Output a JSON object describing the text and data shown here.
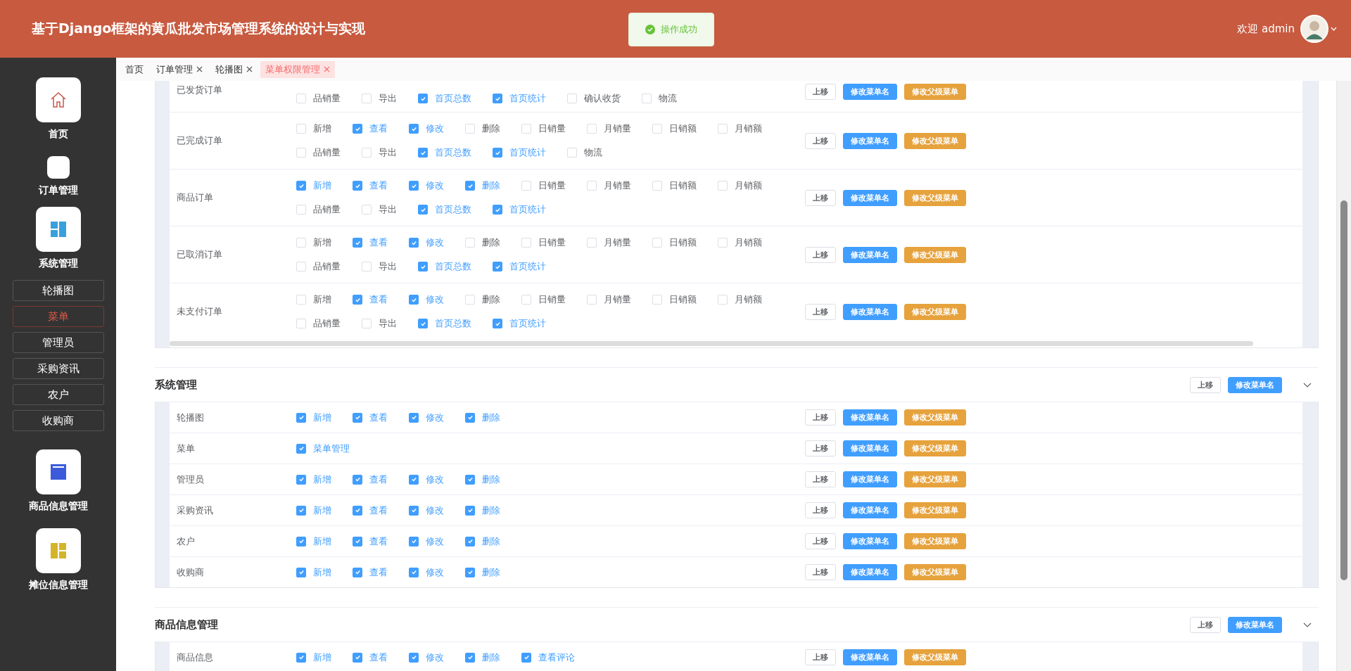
{
  "header": {
    "title": "基于Django框架的黄瓜批发市场管理系统的设计与实现",
    "toast": "操作成功",
    "welcome": "欢迎 admin"
  },
  "sidebar": {
    "items": [
      {
        "label": "首页"
      },
      {
        "label": "订单管理"
      },
      {
        "label": "系统管理",
        "children": [
          {
            "label": "轮播图",
            "selected": false
          },
          {
            "label": "菜单",
            "selected": true
          },
          {
            "label": "管理员",
            "selected": false
          },
          {
            "label": "采购资讯",
            "selected": false
          },
          {
            "label": "农户",
            "selected": false
          },
          {
            "label": "收购商",
            "selected": false
          }
        ]
      },
      {
        "label": "商品信息管理"
      },
      {
        "label": "摊位信息管理"
      }
    ]
  },
  "tabs": [
    {
      "label": "首页",
      "selected": false,
      "closable": false
    },
    {
      "label": "订单管理",
      "selected": false,
      "closable": true
    },
    {
      "label": "轮播图",
      "selected": false,
      "closable": true
    },
    {
      "label": "菜单权限管理",
      "selected": true,
      "closable": true
    }
  ],
  "groups": [
    {
      "rows": [
        {
          "label": "已发货订单",
          "checks": [
            {
              "label": "品销量",
              "checked": false
            },
            {
              "label": "导出",
              "checked": false
            },
            {
              "label": "首页总数",
              "checked": true
            },
            {
              "label": "首页统计",
              "checked": true
            },
            {
              "label": "确认收货",
              "checked": false
            },
            {
              "label": "物流",
              "checked": false
            }
          ],
          "buttons": [
            {
              "label": "上移",
              "kind": "plain"
            },
            {
              "label": "修改菜单名",
              "kind": "primary"
            },
            {
              "label": "修改父级菜单",
              "kind": "warning"
            }
          ]
        },
        {
          "label": "已完成订单",
          "checks": [
            {
              "label": "新增",
              "checked": false
            },
            {
              "label": "查看",
              "checked": true
            },
            {
              "label": "修改",
              "checked": true
            },
            {
              "label": "删除",
              "checked": false
            },
            {
              "label": "日销量",
              "checked": false
            },
            {
              "label": "月销量",
              "checked": false
            },
            {
              "label": "日销额",
              "checked": false
            },
            {
              "label": "月销额",
              "checked": false
            },
            {
              "label": "品销量",
              "checked": false
            },
            {
              "label": "导出",
              "checked": false
            },
            {
              "label": "首页总数",
              "checked": true
            },
            {
              "label": "首页统计",
              "checked": true
            },
            {
              "label": "物流",
              "checked": false
            }
          ],
          "buttons": [
            {
              "label": "上移",
              "kind": "plain"
            },
            {
              "label": "修改菜单名",
              "kind": "primary"
            },
            {
              "label": "修改父级菜单",
              "kind": "warning"
            }
          ]
        },
        {
          "label": "商品订单",
          "checks": [
            {
              "label": "新增",
              "checked": true
            },
            {
              "label": "查看",
              "checked": true
            },
            {
              "label": "修改",
              "checked": true
            },
            {
              "label": "删除",
              "checked": true
            },
            {
              "label": "日销量",
              "checked": false
            },
            {
              "label": "月销量",
              "checked": false
            },
            {
              "label": "日销额",
              "checked": false
            },
            {
              "label": "月销额",
              "checked": false
            },
            {
              "label": "品销量",
              "checked": false
            },
            {
              "label": "导出",
              "checked": false
            },
            {
              "label": "首页总数",
              "checked": true
            },
            {
              "label": "首页统计",
              "checked": true
            }
          ],
          "buttons": [
            {
              "label": "上移",
              "kind": "plain"
            },
            {
              "label": "修改菜单名",
              "kind": "primary"
            },
            {
              "label": "修改父级菜单",
              "kind": "warning"
            }
          ]
        },
        {
          "label": "已取消订单",
          "checks": [
            {
              "label": "新增",
              "checked": false
            },
            {
              "label": "查看",
              "checked": true
            },
            {
              "label": "修改",
              "checked": true
            },
            {
              "label": "删除",
              "checked": false
            },
            {
              "label": "日销量",
              "checked": false
            },
            {
              "label": "月销量",
              "checked": false
            },
            {
              "label": "日销额",
              "checked": false
            },
            {
              "label": "月销额",
              "checked": false
            },
            {
              "label": "品销量",
              "checked": false
            },
            {
              "label": "导出",
              "checked": false
            },
            {
              "label": "首页总数",
              "checked": true
            },
            {
              "label": "首页统计",
              "checked": true
            }
          ],
          "buttons": [
            {
              "label": "上移",
              "kind": "plain"
            },
            {
              "label": "修改菜单名",
              "kind": "primary"
            },
            {
              "label": "修改父级菜单",
              "kind": "warning"
            }
          ]
        },
        {
          "label": "未支付订单",
          "checks": [
            {
              "label": "新增",
              "checked": false
            },
            {
              "label": "查看",
              "checked": true
            },
            {
              "label": "修改",
              "checked": true
            },
            {
              "label": "删除",
              "checked": false
            },
            {
              "label": "日销量",
              "checked": false
            },
            {
              "label": "月销量",
              "checked": false
            },
            {
              "label": "日销额",
              "checked": false
            },
            {
              "label": "月销额",
              "checked": false
            },
            {
              "label": "品销量",
              "checked": false
            },
            {
              "label": "导出",
              "checked": false
            },
            {
              "label": "首页总数",
              "checked": true
            },
            {
              "label": "首页统计",
              "checked": true
            }
          ],
          "buttons": [
            {
              "label": "上移",
              "kind": "plain"
            },
            {
              "label": "修改菜单名",
              "kind": "primary"
            },
            {
              "label": "修改父级菜单",
              "kind": "warning"
            }
          ]
        }
      ]
    },
    {
      "title": "系统管理",
      "expanded": true,
      "buttons": [
        {
          "label": "上移",
          "kind": "plain"
        },
        {
          "label": "修改菜单名",
          "kind": "primary"
        }
      ],
      "rows": [
        {
          "label": "轮播图",
          "checks": [
            {
              "label": "新增",
              "checked": true
            },
            {
              "label": "查看",
              "checked": true
            },
            {
              "label": "修改",
              "checked": true
            },
            {
              "label": "删除",
              "checked": true
            }
          ],
          "buttons": [
            {
              "label": "上移",
              "kind": "plain"
            },
            {
              "label": "修改菜单名",
              "kind": "primary"
            },
            {
              "label": "修改父级菜单",
              "kind": "warning"
            }
          ]
        },
        {
          "label": "菜单",
          "checks": [
            {
              "label": "菜单管理",
              "checked": true
            }
          ],
          "buttons": [
            {
              "label": "上移",
              "kind": "plain"
            },
            {
              "label": "修改菜单名",
              "kind": "primary"
            },
            {
              "label": "修改父级菜单",
              "kind": "warning"
            }
          ]
        },
        {
          "label": "管理员",
          "checks": [
            {
              "label": "新增",
              "checked": true
            },
            {
              "label": "查看",
              "checked": true
            },
            {
              "label": "修改",
              "checked": true
            },
            {
              "label": "删除",
              "checked": true
            }
          ],
          "buttons": [
            {
              "label": "上移",
              "kind": "plain"
            },
            {
              "label": "修改菜单名",
              "kind": "primary"
            },
            {
              "label": "修改父级菜单",
              "kind": "warning"
            }
          ]
        },
        {
          "label": "采购资讯",
          "checks": [
            {
              "label": "新增",
              "checked": true
            },
            {
              "label": "查看",
              "checked": true
            },
            {
              "label": "修改",
              "checked": true
            },
            {
              "label": "删除",
              "checked": true
            }
          ],
          "buttons": [
            {
              "label": "上移",
              "kind": "plain"
            },
            {
              "label": "修改菜单名",
              "kind": "primary"
            },
            {
              "label": "修改父级菜单",
              "kind": "warning"
            }
          ]
        },
        {
          "label": "农户",
          "checks": [
            {
              "label": "新增",
              "checked": true
            },
            {
              "label": "查看",
              "checked": true
            },
            {
              "label": "修改",
              "checked": true
            },
            {
              "label": "删除",
              "checked": true
            }
          ],
          "buttons": [
            {
              "label": "上移",
              "kind": "plain"
            },
            {
              "label": "修改菜单名",
              "kind": "primary"
            },
            {
              "label": "修改父级菜单",
              "kind": "warning"
            }
          ]
        },
        {
          "label": "收购商",
          "checks": [
            {
              "label": "新增",
              "checked": true
            },
            {
              "label": "查看",
              "checked": true
            },
            {
              "label": "修改",
              "checked": true
            },
            {
              "label": "删除",
              "checked": true
            }
          ],
          "buttons": [
            {
              "label": "上移",
              "kind": "plain"
            },
            {
              "label": "修改菜单名",
              "kind": "primary"
            },
            {
              "label": "修改父级菜单",
              "kind": "warning"
            }
          ]
        }
      ]
    },
    {
      "title": "商品信息管理",
      "expanded": true,
      "buttons": [
        {
          "label": "上移",
          "kind": "plain"
        },
        {
          "label": "修改菜单名",
          "kind": "primary"
        }
      ],
      "rows": [
        {
          "label": "商品信息",
          "checks": [
            {
              "label": "新增",
              "checked": true
            },
            {
              "label": "查看",
              "checked": true
            },
            {
              "label": "修改",
              "checked": true
            },
            {
              "label": "删除",
              "checked": true
            },
            {
              "label": "查看评论",
              "checked": true
            }
          ],
          "buttons": [
            {
              "label": "上移",
              "kind": "plain"
            },
            {
              "label": "修改菜单名",
              "kind": "primary"
            },
            {
              "label": "修改父级菜单",
              "kind": "warning"
            }
          ]
        }
      ]
    }
  ]
}
